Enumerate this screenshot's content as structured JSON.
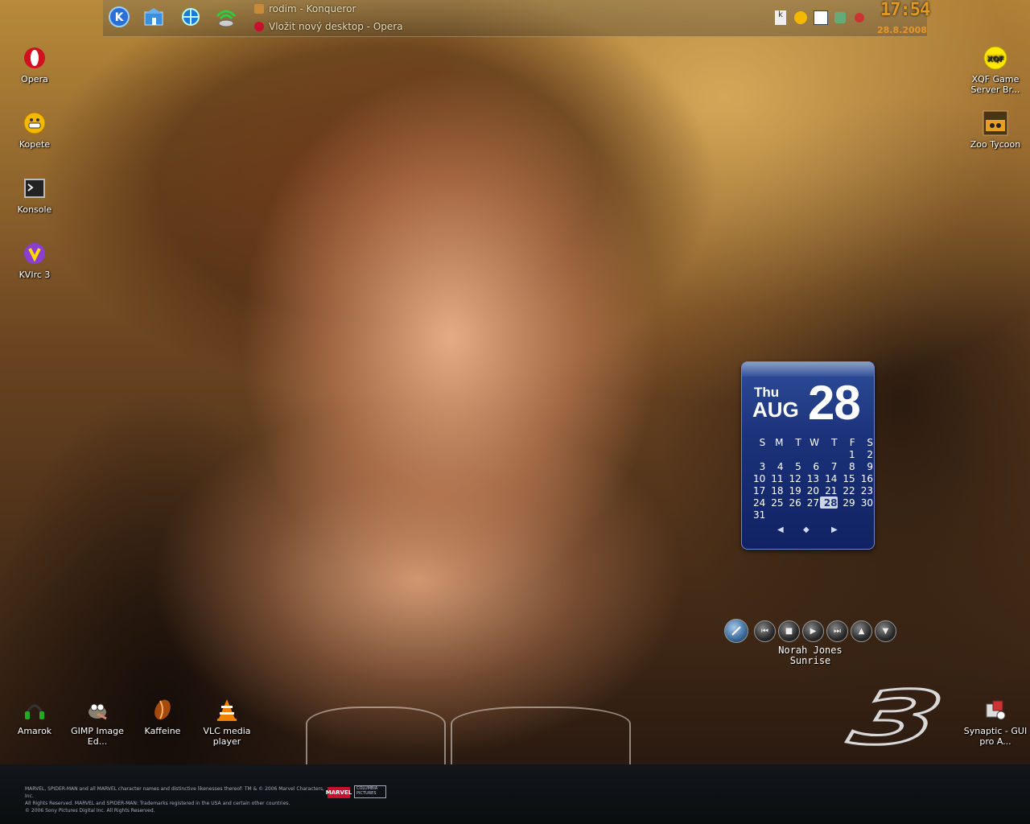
{
  "taskbar": {
    "launchers": [
      {
        "icon": "kde-menu-icon"
      },
      {
        "icon": "home-folder-icon"
      },
      {
        "icon": "konqueror-browser-icon"
      },
      {
        "icon": "network-icon"
      }
    ],
    "tasks": [
      {
        "label": "rodim - Konqueror",
        "icon": "folder-icon"
      },
      {
        "label": "Vložit nový desktop - Opera",
        "icon": "opera-icon"
      }
    ],
    "tray_icons": [
      "klipper-icon",
      "kopete-icon",
      "calendar-icon",
      "network-monitor-icon",
      "amarok-tray-icon"
    ],
    "clock": {
      "time": "17:54",
      "date": "28.8.2008"
    }
  },
  "desktop_icons_left": [
    {
      "label": "Opera",
      "icon": "opera-icon"
    },
    {
      "label": "Kopete",
      "icon": "kopete-icon"
    },
    {
      "label": "Konsole",
      "icon": "terminal-icon"
    },
    {
      "label": "KVIrc 3",
      "icon": "kvirc-icon"
    }
  ],
  "desktop_icons_right": [
    {
      "label": "XQF Game Server Br...",
      "icon": "xqf-icon"
    },
    {
      "label": "Zoo Tycoon",
      "icon": "zoo-tycoon-icon"
    }
  ],
  "desktop_icons_bottom": [
    {
      "label": "Amarok",
      "icon": "amarok-icon"
    },
    {
      "label": "GIMP Image Ed...",
      "icon": "gimp-icon"
    },
    {
      "label": "Kaffeine",
      "icon": "kaffeine-icon"
    },
    {
      "label": "VLC media player",
      "icon": "vlc-icon"
    },
    {
      "label": "Synaptic - GUI pro A...",
      "icon": "synaptic-icon"
    }
  ],
  "calendar": {
    "weekday": "Thu",
    "month": "AUG",
    "day": "28",
    "weekday_headers": [
      "S",
      "M",
      "T",
      "W",
      "T",
      "F",
      "S"
    ],
    "weeks": [
      [
        "",
        "",
        "",
        "",
        "",
        "1",
        "2"
      ],
      [
        "3",
        "4",
        "5",
        "6",
        "7",
        "8",
        "9"
      ],
      [
        "10",
        "11",
        "12",
        "13",
        "14",
        "15",
        "16"
      ],
      [
        "17",
        "18",
        "19",
        "20",
        "21",
        "22",
        "23"
      ],
      [
        "24",
        "25",
        "26",
        "27",
        "28",
        "29",
        "30"
      ],
      [
        "31",
        "",
        "",
        "",
        "",
        "",
        ""
      ]
    ],
    "today": "28",
    "nav": {
      "prev": "◀",
      "today": "◆",
      "next": "▶"
    }
  },
  "player": {
    "artist": "Norah Jones",
    "track": "Sunrise",
    "controls": [
      "amarok-logo-icon",
      "previous-icon",
      "stop-icon",
      "play-icon",
      "next-icon",
      "volume-up-icon",
      "volume-down-icon"
    ]
  },
  "wallpaper_footer": {
    "legal_lines": [
      "MARVEL, SPIDER-MAN and all MARVEL character names and distinctive likenesses thereof: TM & © 2006 Marvel Characters, Inc.",
      "All Rights Reserved. MARVEL and SPIDER-MAN: Trademarks registered in the USA and certain other countries.",
      "© 2006 Sony Pictures Digital Inc. All Rights Reserved."
    ],
    "marvel_logo": "MARVEL",
    "columbia_logo": "COLUMBIA PICTURES",
    "big_numeral": "3"
  },
  "colors": {
    "clock": "#e39a24",
    "calendar_bg": "#1b327a"
  }
}
